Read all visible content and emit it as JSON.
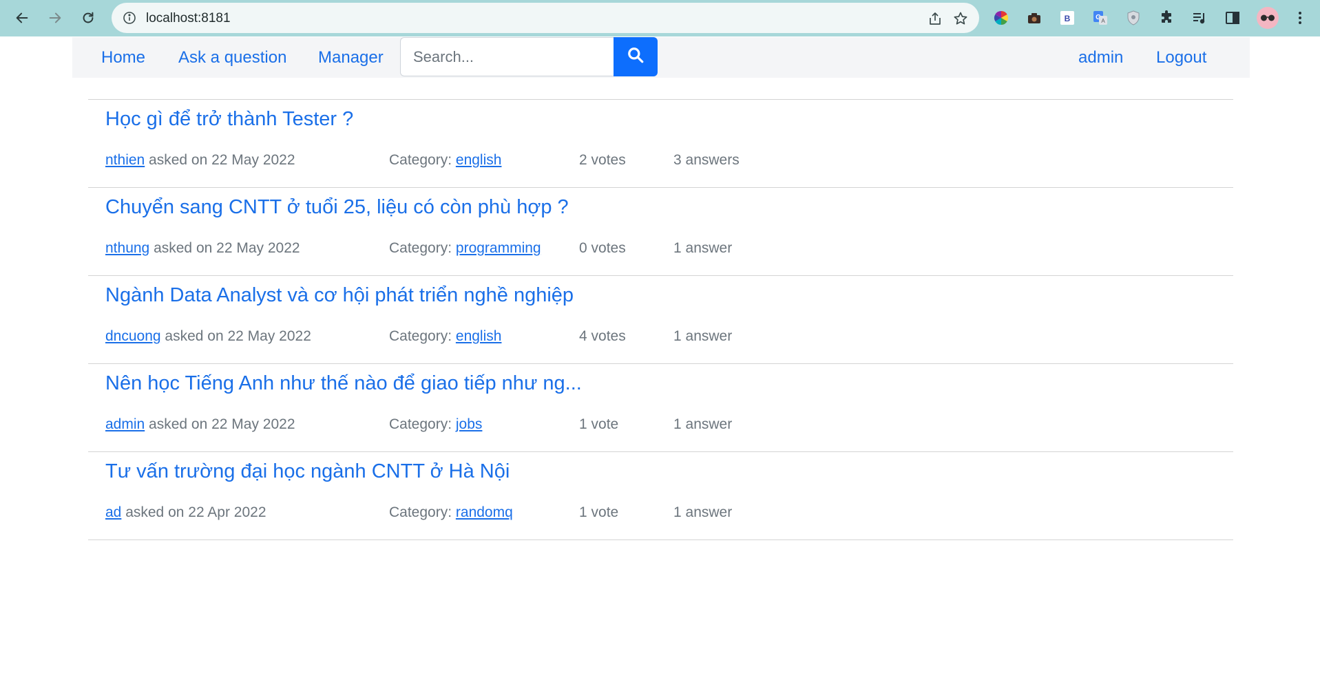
{
  "browser": {
    "url": "localhost:8181"
  },
  "navbar": {
    "links": [
      "Home",
      "Ask a question",
      "Manager"
    ],
    "search_placeholder": "Search...",
    "user": "admin",
    "logout": "Logout"
  },
  "questions": [
    {
      "title": "Học gì để trở thành Tester ?",
      "author": "nthien",
      "asked_text": " asked on 22 May 2022",
      "category_label": "Category: ",
      "category": "english",
      "votes": "2 votes",
      "answers": "3 answers"
    },
    {
      "title": "Chuyển sang CNTT ở tuổi 25, liệu có còn phù hợp ?",
      "author": "nthung",
      "asked_text": " asked on 22 May 2022",
      "category_label": "Category: ",
      "category": "programming",
      "votes": "0 votes",
      "answers": "1 answer"
    },
    {
      "title": "Ngành Data Analyst và cơ hội phát triển nghề nghiệp",
      "author": "dncuong",
      "asked_text": " asked on 22 May 2022",
      "category_label": "Category: ",
      "category": "english",
      "votes": "4 votes",
      "answers": "1 answer"
    },
    {
      "title": "Nên học Tiếng Anh như thế nào để giao tiếp như ng...",
      "author": "admin",
      "asked_text": " asked on 22 May 2022",
      "category_label": "Category: ",
      "category": "jobs",
      "votes": "1 vote",
      "answers": "1 answer"
    },
    {
      "title": "Tư vấn trường đại học ngành CNTT ở Hà Nội",
      "author": "ad",
      "asked_text": " asked on 22 Apr 2022",
      "category_label": "Category: ",
      "category": "randomq",
      "votes": "1 vote",
      "answers": "1 answer"
    }
  ],
  "colors": {
    "chrome": "#a7d7d9",
    "link": "#1a6fe8",
    "search_button": "#0d6efd",
    "navbar_bg": "#f4f5f7",
    "meta_text": "#6c757d"
  },
  "icons": {
    "back": "back-arrow-icon",
    "forward": "forward-arrow-icon",
    "reload": "reload-icon",
    "site_info": "info-icon",
    "share": "share-icon",
    "bookmark": "star-icon",
    "search": "search-icon",
    "menu": "kebab-menu-icon"
  }
}
